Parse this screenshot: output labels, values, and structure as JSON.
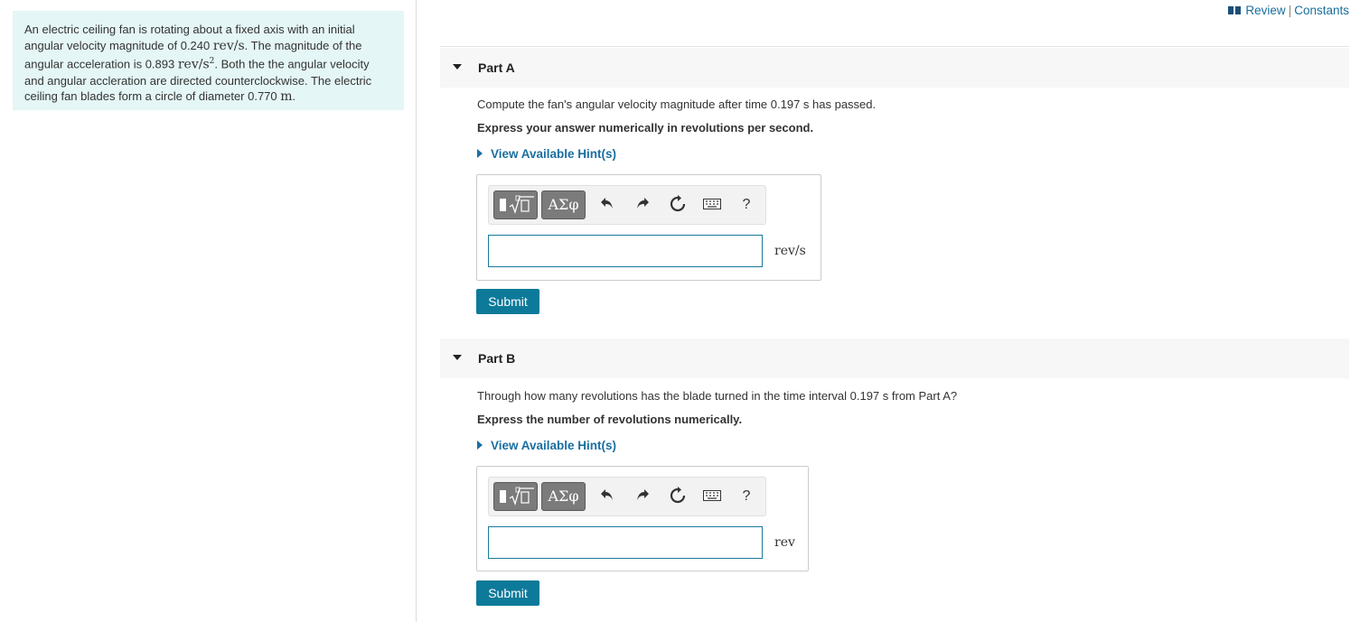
{
  "problem": {
    "line1": "An electric ceiling fan is rotating about a fixed axis with an initial",
    "line2_a": "angular velocity magnitude of 0.240 ",
    "omega_unit": "rev/s",
    "line2_b": ". The magnitude of the",
    "line3_a": "angular acceleration is 0.893 ",
    "alpha_unit": "rev/s",
    "alpha_exp": "2",
    "line3_b": ". Both the the angular velocity",
    "line4": "and angular accleration are directed counterclockwise. The electric",
    "line5_a": "ceiling fan blades form a circle of diameter 0.770 ",
    "diam_unit": "m",
    "line5_b": "."
  },
  "topbar": {
    "review": "Review",
    "separator": "|",
    "constants": "Constants"
  },
  "parts": [
    {
      "label": "Part A",
      "prompt": "Compute the fan's angular velocity magnitude after time 0.197 s has passed.",
      "instruction": "Express your answer numerically in revolutions per second.",
      "hint": "View Available Hint(s)",
      "greek": "ΑΣφ",
      "help": "?",
      "unit": "rev/s",
      "submit": "Submit"
    },
    {
      "label": "Part B",
      "prompt": "Through how many revolutions has the blade turned in the time interval 0.197 s from Part A?",
      "instruction": "Express the number of revolutions numerically.",
      "hint": "View Available Hint(s)",
      "greek": "ΑΣφ",
      "help": "?",
      "unit": "rev",
      "submit": "Submit"
    }
  ],
  "colors": {
    "link": "#1a6fa0",
    "submit_bg": "#0d7a9a",
    "problem_bg": "#e5f6f6",
    "input_border": "#1a7a9c"
  },
  "icons": [
    "book-icon",
    "template-icon",
    "undo-icon",
    "redo-icon",
    "reset-icon",
    "keyboard-icon",
    "help-icon",
    "collapse-triangle-icon",
    "hint-arrow-icon"
  ]
}
